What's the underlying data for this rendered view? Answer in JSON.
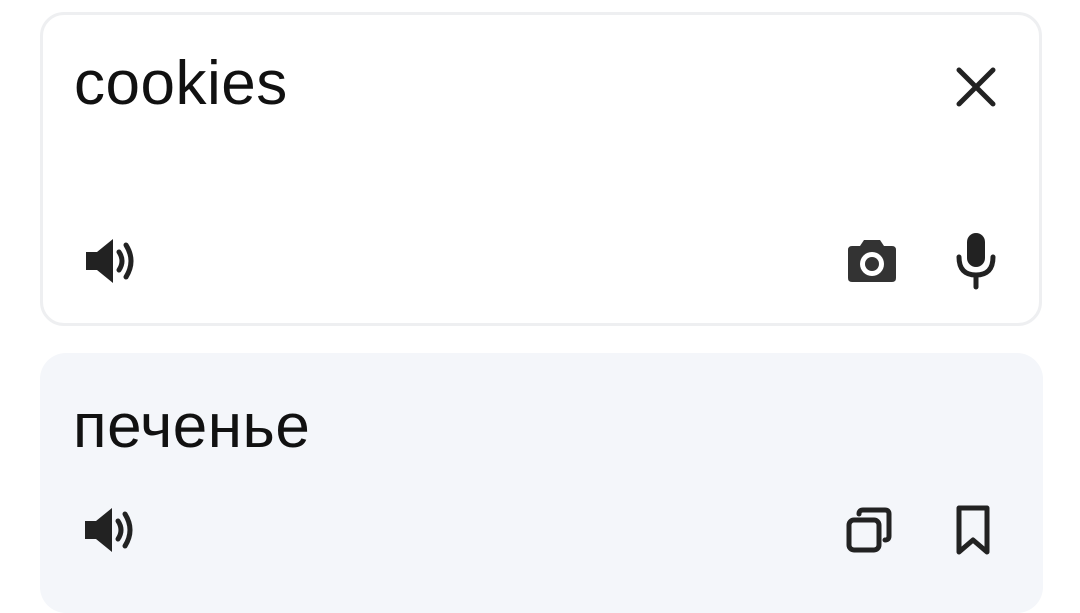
{
  "source": {
    "text": "cookies",
    "icons": {
      "clear": "close-icon",
      "speak": "speaker-icon",
      "camera": "camera-icon",
      "mic": "microphone-icon"
    }
  },
  "translation": {
    "text": "печенье",
    "icons": {
      "speak": "speaker-icon",
      "copy": "copy-icon",
      "save": "bookmark-icon"
    }
  },
  "colors": {
    "icon": "#222222",
    "source_border": "#eeeff1",
    "translation_bg": "#f4f6fa",
    "text": "#111111"
  }
}
